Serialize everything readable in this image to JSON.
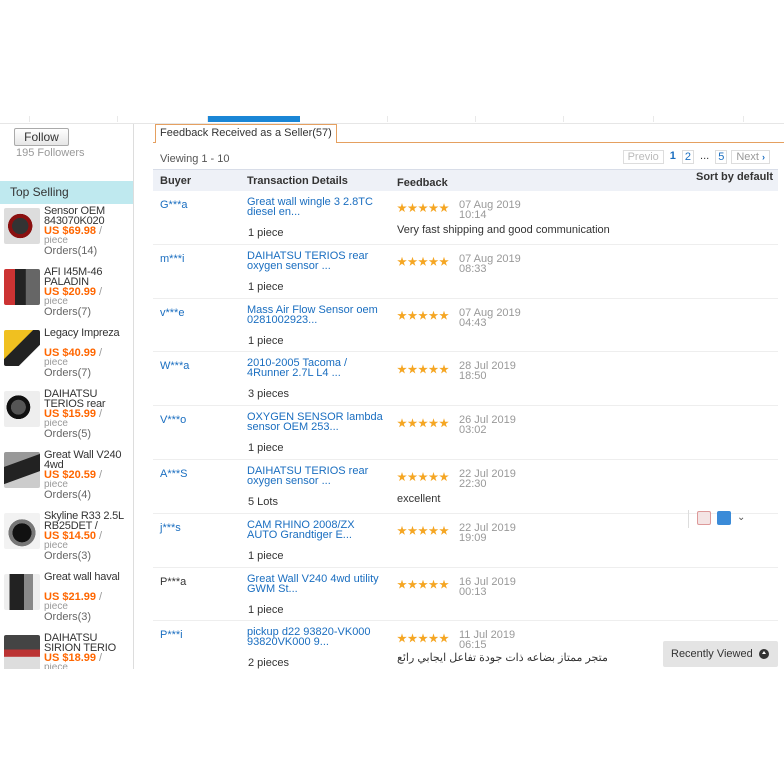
{
  "store": {
    "follow_label": "Follow",
    "followers": "195 Followers"
  },
  "top_selling": {
    "heading": "Top Selling",
    "products": [
      {
        "title": "Sensor OEM 843070K020",
        "price": "US $69.98",
        "slash": "/",
        "unit": "piece",
        "orders": "Orders(14)"
      },
      {
        "title": "AFI I45M-46 PALADIN",
        "price": "US $20.99",
        "slash": "/",
        "unit": "piece",
        "orders": "Orders(7)"
      },
      {
        "title": "Legacy Impreza",
        "price": "US $40.99",
        "slash": "/",
        "unit": "piece",
        "orders": "Orders(7)"
      },
      {
        "title": "DAIHATSU TERIOS rear",
        "price": "US $15.99",
        "slash": "/",
        "unit": "piece",
        "orders": "Orders(5)"
      },
      {
        "title": "Great Wall V240 4wd",
        "price": "US $20.59",
        "slash": "/",
        "unit": "piece",
        "orders": "Orders(4)"
      },
      {
        "title": "Skyline R33 2.5L RB25DET /",
        "price": "US $14.50",
        "slash": "/",
        "unit": "piece",
        "orders": "Orders(3)"
      },
      {
        "title": "Great wall haval",
        "price": "US $21.99",
        "slash": "/",
        "unit": "piece",
        "orders": "Orders(3)"
      },
      {
        "title": "DAIHATSU SIRION TERIO",
        "price": "US $18.99",
        "slash": "/",
        "unit": "piece",
        "orders": ""
      }
    ]
  },
  "feedback": {
    "tab_label": "Feedback Received as a Seller(57)",
    "viewing": "Viewing 1 - 10",
    "pager": {
      "prev": "Previo",
      "pages": [
        "1",
        "2"
      ],
      "dots": "...",
      "last": "5",
      "next": "Next"
    },
    "sort": "Sort by default",
    "columns": {
      "buyer": "Buyer",
      "transaction": "Transaction Details",
      "feedback": "Feedback"
    },
    "rows": [
      {
        "buyer": "G***a",
        "title": "Great wall wingle 3 2.8TC diesel en...",
        "qty": "1 piece",
        "stars": 5,
        "date": "07 Aug 2019",
        "time": "10:14",
        "comment": "Very fast shipping and good communication"
      },
      {
        "buyer": "m***i",
        "title": "DAIHATSU TERIOS rear oxygen sensor ...",
        "qty": "1 piece",
        "stars": 5,
        "date": "07 Aug 2019",
        "time": "08:33",
        "comment": ""
      },
      {
        "buyer": "v***e",
        "title": "Mass Air Flow Sensor oem 0281002923...",
        "qty": "1 piece",
        "stars": 5,
        "date": "07 Aug 2019",
        "time": "04:43",
        "comment": ""
      },
      {
        "buyer": "W***a",
        "title": "2010-2005 Tacoma / 4Runner 2.7L L4 ...",
        "qty": "3 pieces",
        "stars": 5,
        "date": "28 Jul 2019",
        "time": "18:50",
        "comment": ""
      },
      {
        "buyer": "V***o",
        "title": "OXYGEN SENSOR lambda sensor OEM 253...",
        "qty": "1 piece",
        "stars": 5,
        "date": "26 Jul 2019",
        "time": "03:02",
        "comment": ""
      },
      {
        "buyer": "A***S",
        "title": "DAIHATSU TERIOS rear oxygen sensor ...",
        "qty": "5 Lots",
        "stars": 5,
        "date": "22 Jul 2019",
        "time": "22:30",
        "comment": "excellent"
      },
      {
        "buyer": "j***s",
        "title": "CAM RHINO 2008/ZX AUTO Grandtiger E...",
        "qty": "1 piece",
        "stars": 5,
        "date": "22 Jul 2019",
        "time": "19:09",
        "comment": ""
      },
      {
        "buyer": "P***a",
        "title": "Great Wall V240 4wd utility GWM St...",
        "qty": "1 piece",
        "stars": 5,
        "date": "16 Jul 2019",
        "time": "00:13",
        "comment": ""
      },
      {
        "buyer": "P***i",
        "title": "pickup d22 93820-VK000 93820VK000 9...",
        "qty": "2 pieces",
        "stars": 5,
        "date": "11 Jul 2019",
        "time": "06:15",
        "comment": "متجر ممتاز بضاعه ذات جودة تفاعل ايجابي رائع"
      }
    ]
  },
  "recently_viewed": "Recently Viewed",
  "colors": {
    "accent_blue": "#1a6ec0",
    "price_orange": "#ff6600",
    "star": "#f5a623",
    "sidebar_header": "#bfe9ef"
  }
}
